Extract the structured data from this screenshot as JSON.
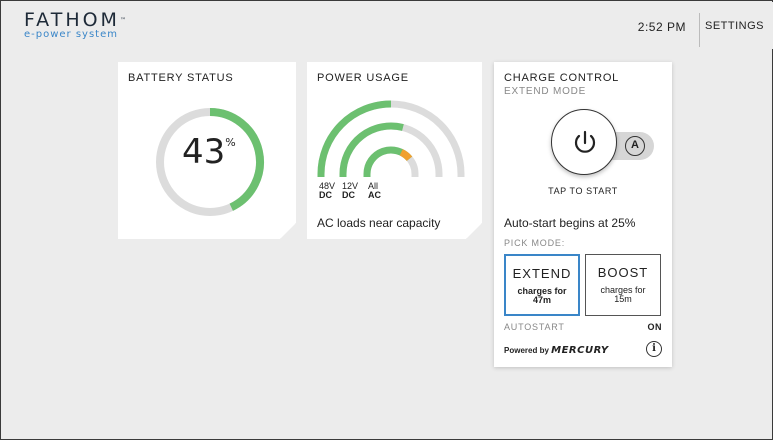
{
  "header": {
    "brand": "FATHOM",
    "brand_tm": "™",
    "tagline": "e-power system",
    "time": "2:52 PM",
    "settings_label": "SETTINGS"
  },
  "battery": {
    "title": "BATTERY STATUS",
    "value": "43",
    "unit": "%",
    "level": 0.43,
    "color_fill": "#6cc070",
    "color_track": "#dcdcdc"
  },
  "power": {
    "title": "POWER USAGE",
    "status": "AC loads near capacity",
    "arcs": [
      {
        "top": "48V",
        "bottom": "DC",
        "level": 0.5,
        "color": "#6cc070"
      },
      {
        "top": "12V",
        "bottom": "DC",
        "level": 0.58,
        "color": "#6cc070"
      },
      {
        "top": "All",
        "bottom": "AC",
        "level": 0.78,
        "color": "#6cc070",
        "warn_color": "#f0a030"
      }
    ],
    "color_track": "#dcdcdc"
  },
  "charge": {
    "title": "CHARGE CONTROL",
    "subtitle": "EXTEND MODE",
    "tap_label": "TAP TO START",
    "auto_glyph": "A",
    "autostart_note": "Auto-start begins at 25%",
    "pick_mode_label": "PICK MODE:",
    "modes": [
      {
        "name": "EXTEND",
        "line1": "charges for",
        "line2": "47m"
      },
      {
        "name": "BOOST",
        "line1": "charges for",
        "line2": "15m"
      }
    ],
    "autostart_label": "AUTOSTART",
    "autostart_value": "ON",
    "powered_by": "Powered by",
    "powered_brand": "MERCURY",
    "info_glyph": "i",
    "accent": "#3a86c8"
  }
}
